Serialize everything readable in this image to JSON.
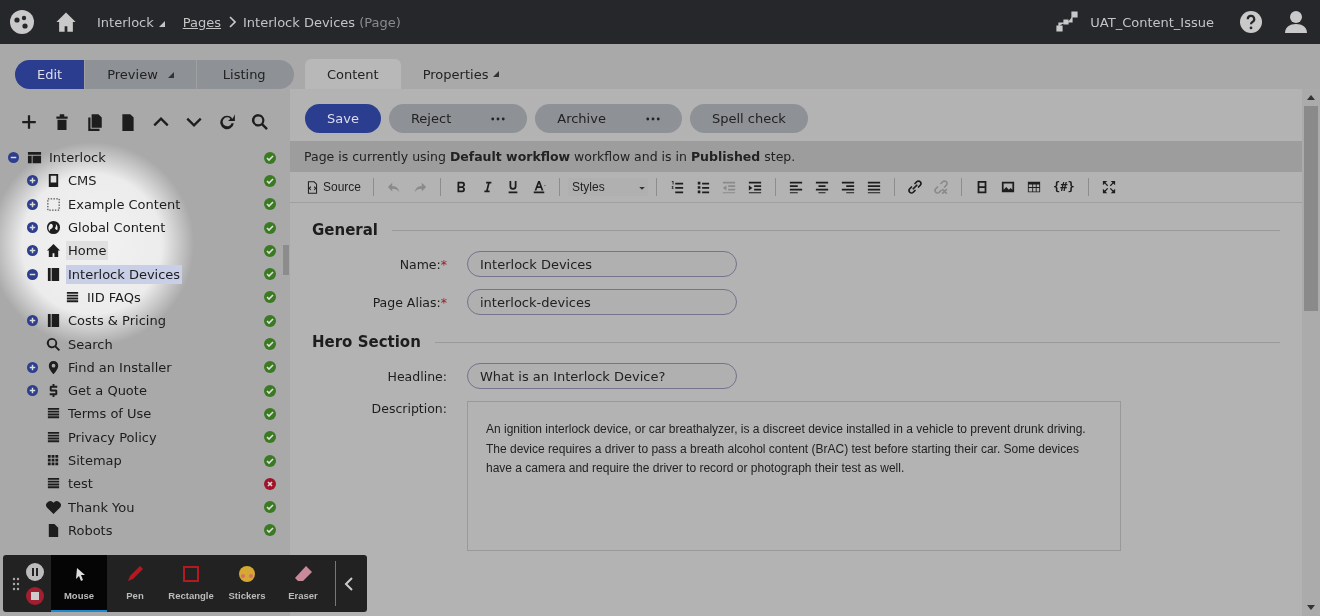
{
  "topbar": {
    "site": "Interlock",
    "breadcrumb_link": "Pages",
    "page_title": "Interlock Devices",
    "page_type": "(Page)",
    "project": "UAT_Content_Issue"
  },
  "modes": [
    {
      "label": "Edit",
      "selected": true,
      "dropdown": false
    },
    {
      "label": "Preview",
      "selected": false,
      "dropdown": true
    },
    {
      "label": "Listing",
      "selected": false,
      "dropdown": false
    }
  ],
  "tree": {
    "label": "Interlock",
    "kind": "table",
    "expanded": true,
    "published": true,
    "selected": false,
    "hovered": false,
    "children": [
      {
        "label": "CMS",
        "kind": "page",
        "expanded": false,
        "published": true,
        "selected": false,
        "hovered": false
      },
      {
        "label": "Example Content",
        "kind": "dashed",
        "expanded": false,
        "published": true,
        "selected": false,
        "hovered": false
      },
      {
        "label": "Global Content",
        "kind": "globe",
        "expanded": false,
        "published": true,
        "selected": false,
        "hovered": false
      },
      {
        "label": "Home",
        "kind": "home",
        "expanded": false,
        "published": true,
        "selected": false,
        "hovered": true
      },
      {
        "label": "Interlock Devices",
        "kind": "book",
        "expanded": true,
        "published": true,
        "selected": true,
        "hovered": false,
        "children": [
          {
            "label": "IID FAQs",
            "kind": "lines",
            "published": true,
            "selected": false,
            "hovered": false
          }
        ]
      },
      {
        "label": "Costs & Pricing",
        "kind": "book",
        "expanded": false,
        "published": true,
        "selected": false,
        "hovered": false
      },
      {
        "label": "Search",
        "kind": "search",
        "published": true,
        "selected": false,
        "hovered": false
      },
      {
        "label": "Find an Installer",
        "kind": "pin",
        "expanded": false,
        "published": true,
        "selected": false,
        "hovered": false
      },
      {
        "label": "Get a Quote",
        "kind": "dollar",
        "expanded": false,
        "published": true,
        "selected": false,
        "hovered": false
      },
      {
        "label": "Terms of Use",
        "kind": "lines",
        "published": true,
        "selected": false,
        "hovered": false
      },
      {
        "label": "Privacy Policy",
        "kind": "lines",
        "published": true,
        "selected": false,
        "hovered": false
      },
      {
        "label": "Sitemap",
        "kind": "grid",
        "published": true,
        "selected": false,
        "hovered": false
      },
      {
        "label": "test",
        "kind": "lines",
        "published": false,
        "selected": false,
        "hovered": false
      },
      {
        "label": "Thank You",
        "kind": "heart",
        "published": true,
        "selected": false,
        "hovered": false
      },
      {
        "label": "Robots",
        "kind": "file",
        "published": true,
        "selected": false,
        "hovered": false
      }
    ]
  },
  "tabs": [
    {
      "label": "Content",
      "selected": true,
      "dropdown": false
    },
    {
      "label": "Properties",
      "selected": false,
      "dropdown": true
    }
  ],
  "actions": [
    {
      "label": "Save",
      "primary": true,
      "more": false
    },
    {
      "label": "Reject",
      "primary": false,
      "more": true
    },
    {
      "label": "Archive",
      "primary": false,
      "more": true
    },
    {
      "label": "Spell check",
      "primary": false,
      "more": false
    }
  ],
  "workflow_message": "Page is currently using **Default workflow** workflow and is in **Published** step.",
  "editor_toolbar": [
    [
      {
        "kind": "source",
        "label": "Source"
      }
    ],
    [
      {
        "kind": "undo",
        "disabled": true
      },
      {
        "kind": "redo",
        "disabled": true
      }
    ],
    [
      {
        "kind": "bold",
        "disabled": false
      },
      {
        "kind": "italic",
        "disabled": false
      },
      {
        "kind": "underline",
        "disabled": false
      },
      {
        "kind": "textcolor",
        "disabled": false
      }
    ],
    [
      {
        "kind": "styles",
        "label": "Styles"
      }
    ],
    [
      {
        "kind": "ol",
        "disabled": false
      },
      {
        "kind": "ul",
        "disabled": false
      },
      {
        "kind": "outdent",
        "disabled": true
      },
      {
        "kind": "indent",
        "disabled": false
      }
    ],
    [
      {
        "kind": "alignleft",
        "disabled": false
      },
      {
        "kind": "aligncenter",
        "disabled": false
      },
      {
        "kind": "alignright",
        "disabled": false
      },
      {
        "kind": "justify",
        "disabled": false
      }
    ],
    [
      {
        "kind": "link",
        "disabled": false
      },
      {
        "kind": "unlink",
        "disabled": true
      }
    ],
    [
      {
        "kind": "block",
        "disabled": false
      },
      {
        "kind": "image",
        "disabled": false
      },
      {
        "kind": "table",
        "disabled": false
      },
      {
        "kind": "code",
        "label": "{#}",
        "disabled": false
      }
    ],
    [
      {
        "kind": "maximize",
        "disabled": false
      }
    ]
  ],
  "sections": [
    {
      "title": "General",
      "fields": [
        {
          "label": "Name:",
          "required_mark": "*",
          "kind": "input",
          "value": "Interlock Devices"
        },
        {
          "label": "Page Alias:",
          "required_mark": "*",
          "kind": "input",
          "value": "interlock-devices"
        }
      ]
    },
    {
      "title": "Hero Section",
      "fields": [
        {
          "label": "Headline:",
          "kind": "input",
          "value": "What is an Interlock Device?"
        },
        {
          "label": "Description:",
          "kind": "richtext",
          "value": "An ignition interlock device, or car breathalyzer, is a discreet device installed in a vehicle to prevent drunk driving. The device requires a driver to pass a breath alcohol content (BrAC) test before starting their car. Some devices have a camera and require the driver to record or photograph their test as well."
        }
      ]
    }
  ],
  "recorder": {
    "tools": [
      {
        "label": "Mouse",
        "kind": "mouse",
        "selected": true
      },
      {
        "label": "Pen",
        "kind": "pen",
        "selected": false
      },
      {
        "label": "Rectangle",
        "kind": "rectangle",
        "selected": false
      },
      {
        "label": "Stickers",
        "kind": "stickers",
        "selected": false
      },
      {
        "label": "Eraser",
        "kind": "eraser",
        "selected": false
      }
    ]
  }
}
